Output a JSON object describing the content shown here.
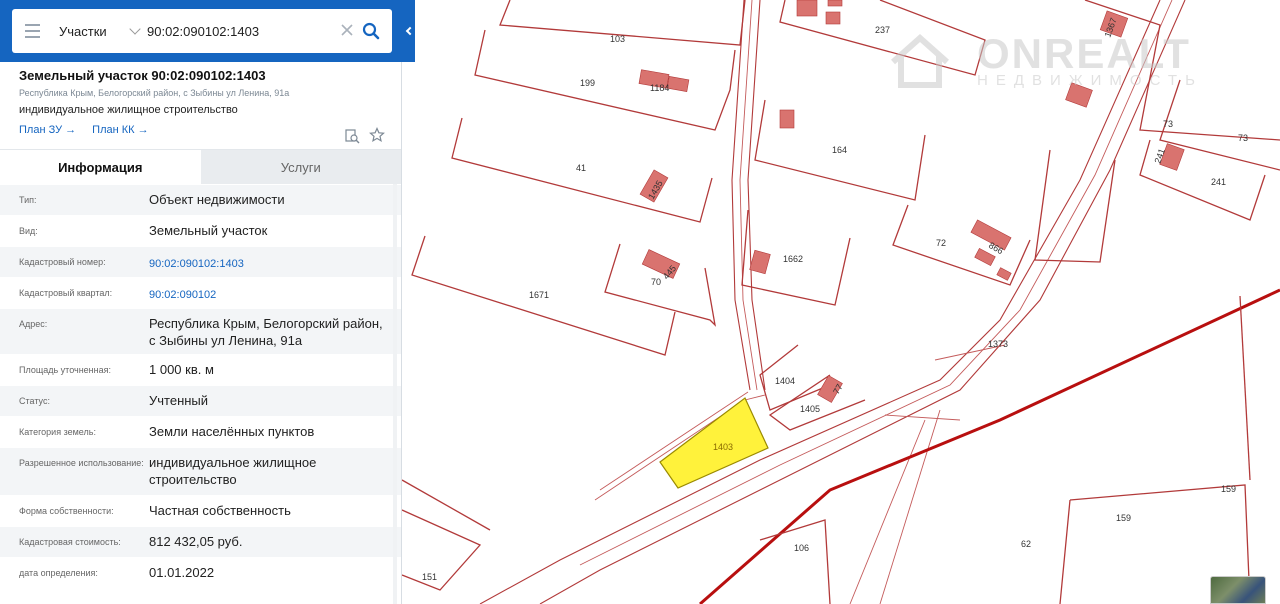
{
  "map": {
    "watermark": {
      "main": "ONREALT",
      "sub": "НЕДВИЖИМОСТЬ"
    },
    "parcels": [
      "103",
      "237",
      "199",
      "1184",
      "164",
      "73",
      "241",
      "1367",
      "41",
      "1435",
      "72",
      "866",
      "1662",
      "1671",
      "70",
      "445",
      "1373",
      "1404",
      "1405",
      "77",
      "1403",
      "159",
      "106",
      "62",
      "151"
    ]
  },
  "search": {
    "type_label": "Участки",
    "query": "90:02:090102:1403"
  },
  "card": {
    "title": "Земельный участок 90:02:090102:1403",
    "address": "Республика Крым, Белогорский район, с Зыбины ул Ленина, 91а",
    "use": "индивидуальное жилищное строительство",
    "link_zu": "План ЗУ",
    "link_kk": "План КК"
  },
  "tabs": {
    "info": "Информация",
    "services": "Услуги"
  },
  "info": [
    {
      "k": "Тип:",
      "v": "Объект недвижимости"
    },
    {
      "k": "Вид:",
      "v": "Земельный участок"
    },
    {
      "k": "Кадастровый номер:",
      "v": "90:02:090102:1403"
    },
    {
      "k": "Кадастровый квартал:",
      "v": "90:02:090102"
    },
    {
      "k": "Адрес:",
      "v": "Республика Крым, Белогорский район, с Зыбины ул Ленина, 91а"
    },
    {
      "k": "Площадь уточненная:",
      "v": "1 000 кв. м"
    },
    {
      "k": "Статус:",
      "v": "Учтенный"
    },
    {
      "k": "Категория земель:",
      "v": "Земли населённых пунктов"
    },
    {
      "k": "Разрешенное использование:",
      "v": "индивидуальное жилищное строительство"
    },
    {
      "k": "Форма собственности:",
      "v": "Частная собственность"
    },
    {
      "k": "Кадастровая стоимость:",
      "v": "812 432,05 руб."
    },
    {
      "k": "дата определения:",
      "v": "01.01.2022"
    }
  ]
}
